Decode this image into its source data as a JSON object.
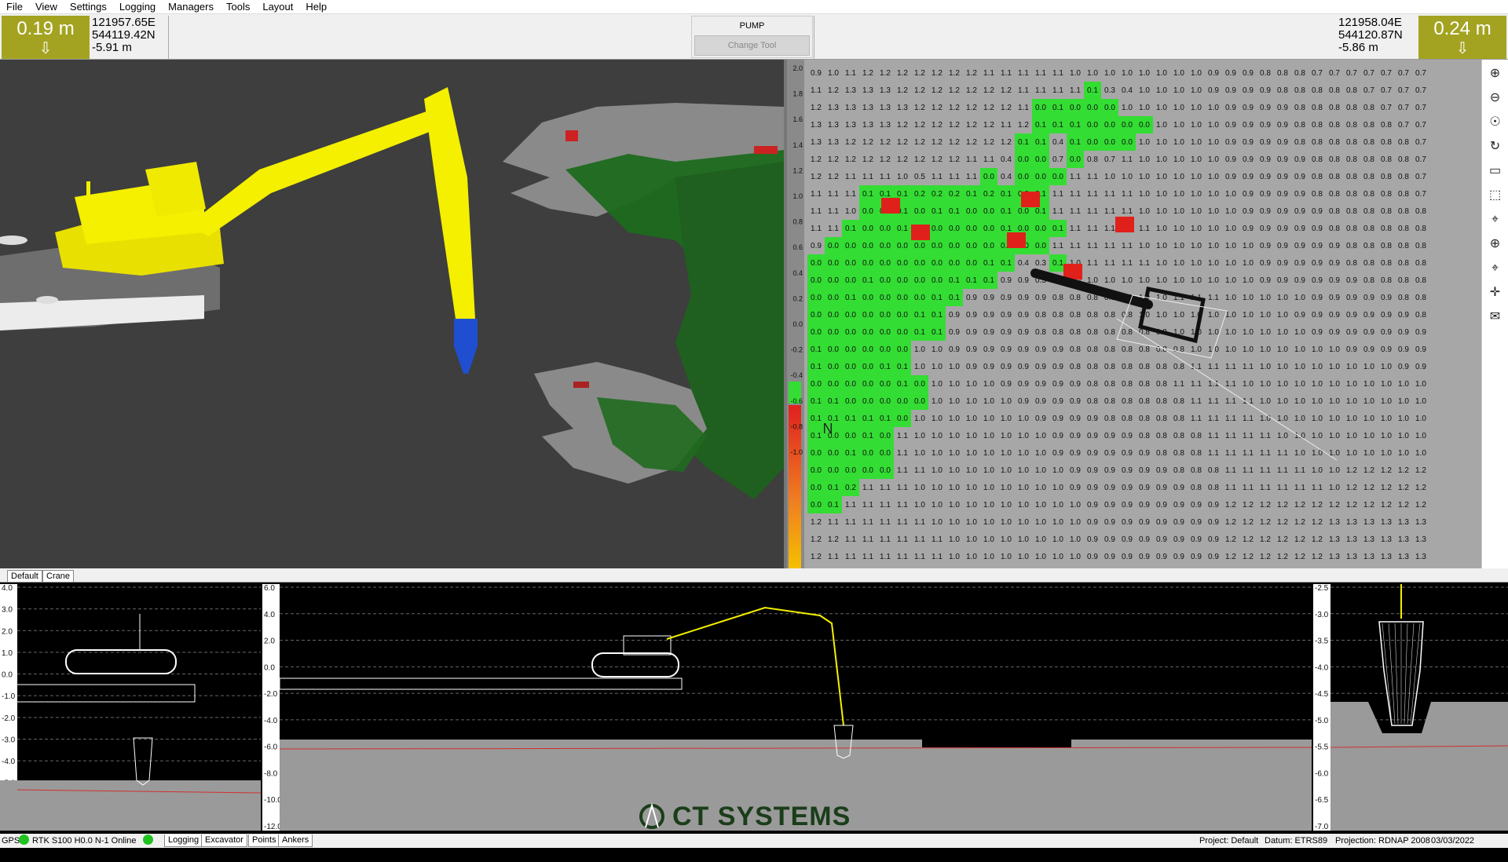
{
  "menu": [
    "File",
    "View",
    "Settings",
    "Logging",
    "Managers",
    "Tools",
    "Layout",
    "Help"
  ],
  "left_readout": {
    "depth": "0.19 m",
    "easting": "121957.65E",
    "northing": "544119.42N",
    "elevation": "-5.91 m"
  },
  "right_readout": {
    "depth": "0.24 m",
    "easting": "121958.04E",
    "northing": "544120.87N",
    "elevation": "-5.86 m"
  },
  "pump": {
    "label": "PUMP",
    "change_tool": "Change Tool"
  },
  "nav_pad": {
    "center": "M"
  },
  "colorbar_ticks": [
    "2.0",
    "1.8",
    "1.6",
    "1.4",
    "1.2",
    "1.0",
    "0.8",
    "0.6",
    "0.4",
    "0.2",
    "0.0",
    "-0.2",
    "-0.4",
    "-0.6",
    "-0.8",
    "-1.0"
  ],
  "north_label": "N",
  "view_tabs": [
    "Default",
    "Crane"
  ],
  "side_axis_ticks": [
    "4.0",
    "3.0",
    "2.0",
    "1.0",
    "0.0",
    "-1.0",
    "-2.0",
    "-3.0",
    "-4.0",
    "-5.0",
    "-6.0",
    "-7.0"
  ],
  "long_axis_ticks": [
    "6.0",
    "4.0",
    "2.0",
    "0.0",
    "-2.0",
    "-4.0",
    "-6.0",
    "-8.0",
    "-10.0",
    "-12.0"
  ],
  "bucket_axis_ticks": [
    "-2.5",
    "-3.0",
    "-3.5",
    "-4.0",
    "-4.5",
    "-5.0",
    "-5.5",
    "-6.0",
    "-6.5",
    "-7.0"
  ],
  "logo": "CT SYSTEMS",
  "status": {
    "gps": "GPS",
    "rtk": "RTK S100 H0.0 N-1 Online",
    "tabs": [
      "Logging",
      "Excavator",
      "Points",
      "Ankers"
    ],
    "project": "Project: Default",
    "datum": "Datum: ETRS89",
    "projection": "Projection: RDNAP 2008",
    "datetime": "03/03/2022 13:05:23"
  },
  "colors": {
    "accent": "#a3a321",
    "machine": "#f4f000",
    "dug": "#33dd33",
    "overcut": "#e0201a",
    "bucket": "#1f4fd0"
  },
  "grid_values": [
    [
      0.9,
      1.0,
      1.1,
      1.2,
      1.2,
      1.2,
      1.2,
      1.2,
      1.2,
      1.2,
      1.1,
      1.1,
      1.1,
      1.1,
      1.1,
      1.0,
      1.0,
      1.0,
      1.0,
      1.0,
      1.0,
      1.0,
      1.0,
      0.9,
      0.9,
      0.9,
      0.8,
      0.8,
      0.8,
      0.7,
      0.7,
      0.7,
      0.7,
      0.7,
      0.7,
      0.7
    ],
    [
      1.1,
      1.2,
      1.3,
      1.3,
      1.3,
      1.2,
      1.2,
      1.2,
      1.2,
      1.2,
      1.2,
      1.2,
      1.1,
      1.1,
      1.1,
      1.1,
      0.1,
      0.3,
      0.4,
      1.0,
      1.0,
      1.0,
      1.0,
      0.9,
      0.9,
      0.9,
      0.9,
      0.8,
      0.8,
      0.8,
      0.8,
      0.8,
      0.7,
      0.7,
      0.7,
      0.7
    ],
    [
      1.2,
      1.3,
      1.3,
      1.3,
      1.3,
      1.3,
      1.2,
      1.2,
      1.2,
      1.2,
      1.2,
      1.2,
      1.1,
      0.0,
      0.1,
      0.0,
      0.0,
      0.0,
      1.0,
      1.0,
      1.0,
      1.0,
      1.0,
      1.0,
      0.9,
      0.9,
      0.9,
      0.9,
      0.8,
      0.8,
      0.8,
      0.8,
      0.8,
      0.7,
      0.7,
      0.7
    ],
    [
      1.3,
      1.3,
      1.3,
      1.3,
      1.3,
      1.2,
      1.2,
      1.2,
      1.2,
      1.2,
      1.2,
      1.1,
      1.2,
      0.1,
      0.1,
      0.1,
      0.0,
      0.0,
      0.0,
      0.0,
      1.0,
      1.0,
      1.0,
      1.0,
      0.9,
      0.9,
      0.9,
      0.9,
      0.8,
      0.8,
      0.8,
      0.8,
      0.8,
      0.8,
      0.7,
      0.7
    ],
    [
      1.3,
      1.3,
      1.2,
      1.2,
      1.2,
      1.2,
      1.2,
      1.2,
      1.2,
      1.2,
      1.2,
      1.2,
      0.1,
      0.1,
      0.4,
      0.1,
      0.0,
      0.0,
      0.0,
      1.0,
      1.0,
      1.0,
      1.0,
      1.0,
      0.9,
      0.9,
      0.9,
      0.9,
      0.8,
      0.8,
      0.8,
      0.8,
      0.8,
      0.8,
      0.8,
      0.7
    ],
    [
      1.2,
      1.2,
      1.2,
      1.2,
      1.2,
      1.2,
      1.2,
      1.2,
      1.2,
      1.1,
      1.1,
      0.4,
      0.0,
      0.0,
      0.7,
      0.0,
      0.8,
      0.7,
      1.1,
      1.0,
      1.0,
      1.0,
      1.0,
      1.0,
      0.9,
      0.9,
      0.9,
      0.9,
      0.9,
      0.8,
      0.8,
      0.8,
      0.8,
      0.8,
      0.8,
      0.7
    ],
    [
      1.2,
      1.2,
      1.1,
      1.1,
      1.1,
      1.0,
      0.5,
      1.1,
      1.1,
      1.1,
      0.0,
      0.4,
      0.0,
      0.0,
      0.0,
      1.1,
      1.1,
      1.0,
      1.0,
      1.0,
      1.0,
      1.0,
      1.0,
      1.0,
      0.9,
      0.9,
      0.9,
      0.9,
      0.9,
      0.8,
      0.8,
      0.8,
      0.8,
      0.8,
      0.8,
      0.7
    ],
    [
      1.1,
      1.1,
      1.1,
      0.1,
      0.1,
      0.1,
      0.2,
      0.2,
      0.2,
      0.1,
      0.2,
      0.1,
      0.0,
      0.1,
      1.1,
      1.1,
      1.1,
      1.1,
      1.1,
      1.0,
      1.0,
      1.0,
      1.0,
      1.0,
      1.0,
      0.9,
      0.9,
      0.9,
      0.9,
      0.8,
      0.8,
      0.8,
      0.8,
      0.8,
      0.8,
      0.7
    ],
    [
      1.1,
      1.1,
      1.0,
      0.0,
      0.0,
      0.1,
      0.0,
      0.1,
      0.1,
      0.0,
      0.0,
      0.1,
      0.0,
      0.1,
      1.1,
      1.1,
      1.1,
      1.1,
      1.1,
      1.0,
      1.0,
      1.0,
      1.0,
      1.0,
      1.0,
      0.9,
      0.9,
      0.9,
      0.9,
      0.9,
      0.8,
      0.8,
      0.8,
      0.8,
      0.8,
      0.8
    ],
    [
      1.1,
      1.1,
      0.1,
      0.0,
      0.0,
      0.1,
      0.1,
      0.0,
      0.0,
      0.0,
      0.0,
      0.1,
      0.0,
      0.0,
      0.1,
      1.1,
      1.1,
      1.1,
      1.1,
      1.1,
      1.0,
      1.0,
      1.0,
      1.0,
      1.0,
      0.9,
      0.9,
      0.9,
      0.9,
      0.9,
      0.8,
      0.8,
      0.8,
      0.8,
      0.8,
      0.8
    ],
    [
      0.9,
      0.0,
      0.0,
      0.0,
      0.0,
      0.0,
      0.0,
      0.0,
      0.0,
      0.0,
      0.0,
      0.0,
      0.0,
      0.0,
      1.1,
      1.1,
      1.1,
      1.1,
      1.1,
      1.0,
      1.0,
      1.0,
      1.0,
      1.0,
      1.0,
      1.0,
      0.9,
      0.9,
      0.9,
      0.9,
      0.9,
      0.8,
      0.8,
      0.8,
      0.8,
      0.8
    ],
    [
      0.0,
      0.0,
      0.0,
      0.0,
      0.0,
      0.0,
      0.0,
      0.0,
      0.0,
      0.0,
      0.1,
      0.1,
      0.4,
      0.3,
      0.1,
      1.0,
      1.1,
      1.1,
      1.1,
      1.1,
      1.0,
      1.0,
      1.0,
      1.0,
      1.0,
      1.0,
      0.9,
      0.9,
      0.9,
      0.9,
      0.9,
      0.8,
      0.8,
      0.8,
      0.8,
      0.8
    ],
    [
      0.0,
      0.0,
      0.0,
      0.1,
      0.0,
      0.0,
      0.0,
      0.0,
      0.1,
      0.1,
      0.1,
      0.9,
      0.9,
      0.3,
      0.9,
      1.0,
      1.0,
      1.0,
      1.0,
      1.0,
      1.0,
      1.0,
      1.0,
      1.0,
      1.0,
      1.0,
      0.9,
      0.9,
      0.9,
      0.9,
      0.9,
      0.9,
      0.8,
      0.8,
      0.8,
      0.8
    ],
    [
      0.0,
      0.0,
      0.1,
      0.0,
      0.0,
      0.0,
      0.0,
      0.1,
      0.1,
      0.9,
      0.9,
      0.9,
      0.9,
      0.9,
      0.8,
      0.8,
      0.8,
      0.8,
      1.0,
      1.0,
      1.0,
      1.1,
      1.1,
      1.1,
      1.0,
      1.0,
      1.0,
      1.0,
      1.0,
      0.9,
      0.9,
      0.9,
      0.9,
      0.9,
      0.8,
      0.8
    ],
    [
      0.0,
      0.0,
      0.0,
      0.0,
      0.0,
      0.0,
      0.1,
      0.1,
      0.9,
      0.9,
      0.9,
      0.9,
      0.9,
      0.8,
      0.8,
      0.8,
      0.8,
      0.8,
      0.8,
      1.0,
      1.0,
      1.0,
      1.0,
      1.0,
      1.0,
      1.0,
      1.0,
      1.0,
      0.9,
      0.9,
      0.9,
      0.9,
      0.9,
      0.9,
      0.9,
      0.8
    ],
    [
      0.0,
      0.0,
      0.0,
      0.0,
      0.0,
      0.0,
      0.1,
      0.1,
      0.9,
      0.9,
      0.9,
      0.9,
      0.9,
      0.8,
      0.8,
      0.8,
      0.8,
      0.8,
      0.8,
      0.8,
      0.8,
      1.0,
      1.0,
      1.0,
      1.0,
      1.0,
      1.0,
      1.0,
      1.0,
      0.9,
      0.9,
      0.9,
      0.9,
      0.9,
      0.9,
      0.9
    ],
    [
      0.1,
      0.0,
      0.0,
      0.0,
      0.0,
      0.0,
      1.0,
      1.0,
      0.9,
      0.9,
      0.9,
      0.9,
      0.9,
      0.9,
      0.9,
      0.8,
      0.8,
      0.8,
      0.8,
      0.8,
      0.8,
      0.8,
      1.0,
      1.0,
      1.0,
      1.0,
      1.0,
      1.0,
      1.0,
      1.0,
      1.0,
      0.9,
      0.9,
      0.9,
      0.9,
      0.9
    ],
    [
      0.1,
      0.0,
      0.0,
      0.0,
      0.1,
      0.1,
      1.0,
      1.0,
      1.0,
      0.9,
      0.9,
      0.9,
      0.9,
      0.9,
      0.9,
      0.8,
      0.8,
      0.8,
      0.8,
      0.8,
      0.8,
      0.8,
      1.1,
      1.1,
      1.1,
      1.1,
      1.0,
      1.0,
      1.0,
      1.0,
      1.0,
      1.0,
      1.0,
      1.0,
      0.9,
      0.9
    ],
    [
      0.0,
      0.0,
      0.0,
      0.0,
      0.0,
      0.1,
      0.0,
      1.0,
      1.0,
      1.0,
      1.0,
      0.9,
      0.9,
      0.9,
      0.9,
      0.9,
      0.8,
      0.8,
      0.8,
      0.8,
      0.8,
      1.1,
      1.1,
      1.1,
      1.1,
      1.0,
      1.0,
      1.0,
      1.0,
      1.0,
      1.0,
      1.0,
      1.0,
      1.0,
      1.0,
      1.0
    ],
    [
      0.1,
      0.1,
      0.0,
      0.0,
      0.0,
      0.0,
      0.0,
      1.0,
      1.0,
      1.0,
      1.0,
      1.0,
      0.9,
      0.9,
      0.9,
      0.9,
      0.8,
      0.8,
      0.8,
      0.8,
      0.8,
      0.8,
      1.1,
      1.1,
      1.1,
      1.1,
      1.0,
      1.0,
      1.0,
      1.0,
      1.0,
      1.0,
      1.0,
      1.0,
      1.0,
      1.0
    ],
    [
      0.1,
      0.1,
      0.1,
      0.1,
      0.1,
      0.0,
      1.0,
      1.0,
      1.0,
      1.0,
      1.0,
      1.0,
      1.0,
      0.9,
      0.9,
      0.9,
      0.9,
      0.8,
      0.8,
      0.8,
      0.8,
      0.8,
      1.1,
      1.1,
      1.1,
      1.1,
      1.0,
      1.0,
      1.0,
      1.0,
      1.0,
      1.0,
      1.0,
      1.0,
      1.0,
      1.0
    ],
    [
      0.1,
      0.0,
      0.0,
      0.1,
      0.0,
      1.1,
      1.0,
      1.0,
      1.0,
      1.0,
      1.0,
      1.0,
      1.0,
      1.0,
      0.9,
      0.9,
      0.9,
      0.9,
      0.9,
      0.8,
      0.8,
      0.8,
      0.8,
      1.1,
      1.1,
      1.1,
      1.1,
      1.0,
      1.0,
      1.0,
      1.0,
      1.0,
      1.0,
      1.0,
      1.0,
      1.0
    ],
    [
      0.0,
      0.0,
      0.1,
      0.0,
      0.0,
      1.1,
      1.0,
      1.0,
      1.0,
      1.0,
      1.0,
      1.0,
      1.0,
      1.0,
      0.9,
      0.9,
      0.9,
      0.9,
      0.9,
      0.9,
      0.8,
      0.8,
      0.8,
      1.1,
      1.1,
      1.1,
      1.1,
      1.1,
      1.0,
      1.0,
      1.0,
      1.0,
      1.0,
      1.0,
      1.0,
      1.0
    ],
    [
      0.0,
      0.0,
      0.0,
      0.0,
      0.0,
      1.1,
      1.1,
      1.0,
      1.0,
      1.0,
      1.0,
      1.0,
      1.0,
      1.0,
      1.0,
      0.9,
      0.9,
      0.9,
      0.9,
      0.9,
      0.9,
      0.8,
      0.8,
      0.8,
      1.1,
      1.1,
      1.1,
      1.1,
      1.1,
      1.0,
      1.0,
      1.2,
      1.2,
      1.2,
      1.2,
      1.2
    ],
    [
      0.0,
      0.1,
      0.2,
      1.1,
      1.1,
      1.1,
      1.0,
      1.0,
      1.0,
      1.0,
      1.0,
      1.0,
      1.0,
      1.0,
      1.0,
      0.9,
      0.9,
      0.9,
      0.9,
      0.9,
      0.9,
      0.9,
      0.8,
      0.8,
      1.1,
      1.1,
      1.1,
      1.1,
      1.1,
      1.1,
      1.0,
      1.2,
      1.2,
      1.2,
      1.2,
      1.2
    ],
    [
      0.0,
      0.1,
      1.1,
      1.1,
      1.1,
      1.1,
      1.0,
      1.0,
      1.0,
      1.0,
      1.0,
      1.0,
      1.0,
      1.0,
      1.0,
      1.0,
      0.9,
      0.9,
      0.9,
      0.9,
      0.9,
      0.9,
      0.9,
      0.9,
      1.2,
      1.2,
      1.2,
      1.2,
      1.2,
      1.2,
      1.2,
      1.2,
      1.2,
      1.2,
      1.2,
      1.2
    ],
    [
      1.2,
      1.1,
      1.1,
      1.1,
      1.1,
      1.1,
      1.1,
      1.0,
      1.0,
      1.0,
      1.0,
      1.0,
      1.0,
      1.0,
      1.0,
      1.0,
      0.9,
      0.9,
      0.9,
      0.9,
      0.9,
      0.9,
      0.9,
      0.9,
      1.2,
      1.2,
      1.2,
      1.2,
      1.2,
      1.2,
      1.3,
      1.3,
      1.3,
      1.3,
      1.3,
      1.3
    ],
    [
      1.2,
      1.2,
      1.1,
      1.1,
      1.1,
      1.1,
      1.1,
      1.1,
      1.0,
      1.0,
      1.0,
      1.0,
      1.0,
      1.0,
      1.0,
      1.0,
      0.9,
      0.9,
      0.9,
      0.9,
      0.9,
      0.9,
      0.9,
      0.9,
      1.2,
      1.2,
      1.2,
      1.2,
      1.2,
      1.2,
      1.3,
      1.3,
      1.3,
      1.3,
      1.3,
      1.3
    ],
    [
      1.2,
      1.1,
      1.1,
      1.1,
      1.1,
      1.1,
      1.1,
      1.1,
      1.0,
      1.0,
      1.0,
      1.0,
      1.0,
      1.0,
      1.0,
      1.0,
      0.9,
      0.9,
      0.9,
      0.9,
      0.9,
      0.9,
      0.9,
      0.9,
      1.2,
      1.2,
      1.2,
      1.2,
      1.2,
      1.2,
      1.3,
      1.3,
      1.3,
      1.3,
      1.3,
      1.3
    ]
  ]
}
